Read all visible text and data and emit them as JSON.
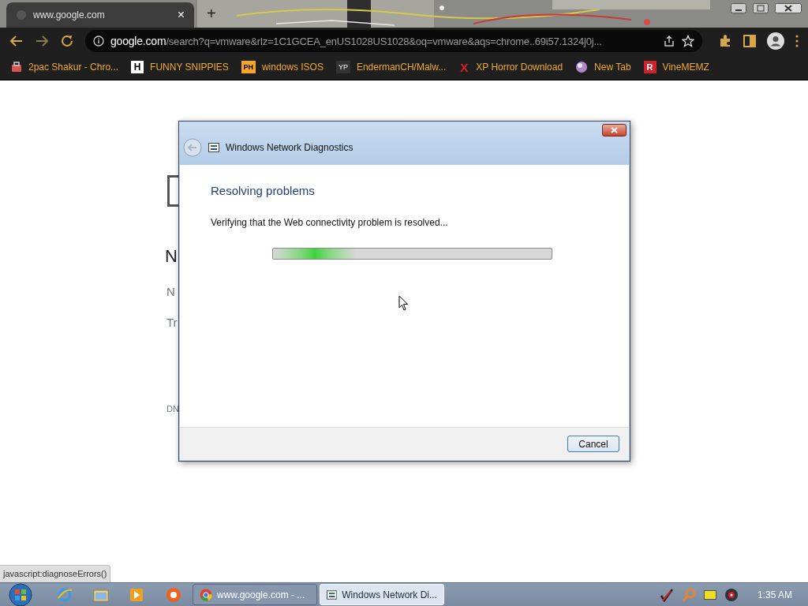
{
  "browser": {
    "tab": {
      "title": "www.google.com",
      "close": "×"
    },
    "new_tab": "+",
    "address": {
      "host": "google.com",
      "path": "/search?q=vmware&rlz=1C1GCEA_enUS1028US1028&oq=vmware&aqs=chrome..69i57.1324j0j..."
    },
    "bookmarks": [
      {
        "label": "2pac Shakur - Chro..."
      },
      {
        "label": "FUNNY SNIPPIES",
        "badge": "H"
      },
      {
        "label": "windows ISOS",
        "badge": "PH"
      },
      {
        "label": "EndermanCH/Malw...",
        "badge": "YP"
      },
      {
        "label": "XP Horror Download",
        "badge": "X"
      },
      {
        "label": "New Tab"
      },
      {
        "label": "VineMEMZ",
        "badge": "R"
      }
    ]
  },
  "page_fragments": [
    "N",
    "N",
    "Tr",
    "DN"
  ],
  "dialog": {
    "title": "Windows Network Diagnostics",
    "heading": "Resolving problems",
    "message": "Verifying that the Web connectivity problem is resolved...",
    "cancel": "Cancel",
    "progress": {
      "level": 0.3
    }
  },
  "status_bubble": "javascript:diagnoseErrors()",
  "taskbar": {
    "windows": [
      {
        "label": "www.google.com - ...",
        "selected": false
      },
      {
        "label": "Windows Network Di...",
        "selected": true
      }
    ],
    "clock": "1:35 AM"
  }
}
